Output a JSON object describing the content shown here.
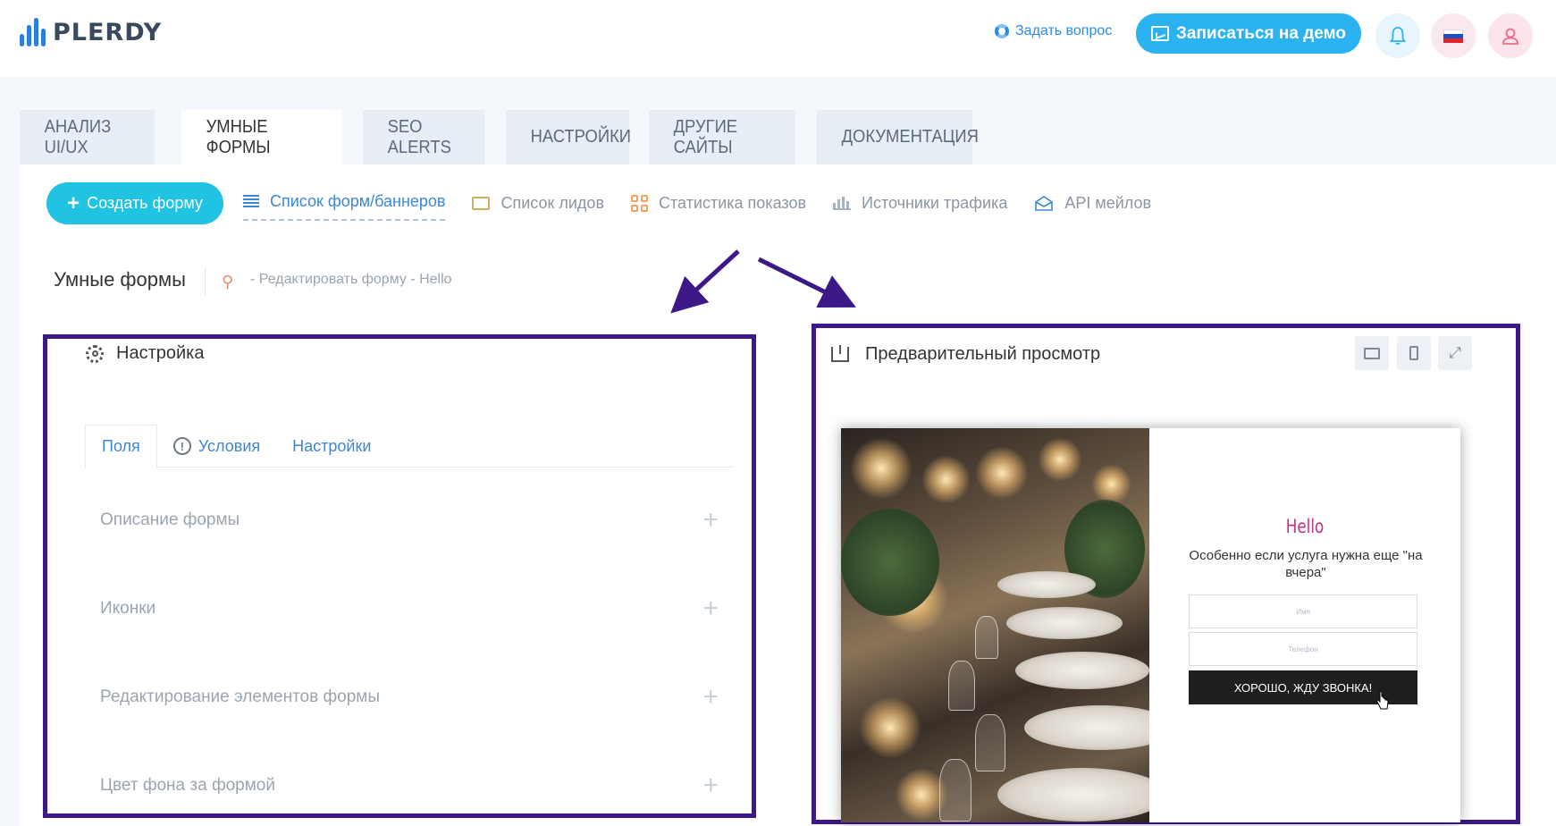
{
  "header": {
    "logo_text": "PLERDY",
    "ask_label": "Задать вопрос",
    "demo_label": "Записаться на демо",
    "colors": {
      "accent": "#2ab3f0",
      "brand": "#2b7de0"
    }
  },
  "tabs": [
    {
      "label": "АНАЛИЗ UI/UX"
    },
    {
      "label": "УМНЫЕ ФОРМЫ"
    },
    {
      "label": "SEO ALERTS"
    },
    {
      "label": "НАСТРОЙКИ"
    },
    {
      "label": "ДРУГИЕ САЙТЫ"
    },
    {
      "label": "ДОКУМЕНТАЦИЯ"
    }
  ],
  "subnav": {
    "create_label": "Создать форму",
    "items": [
      {
        "label": "Список форм/баннеров",
        "icon": "list-icon"
      },
      {
        "label": "Список лидов",
        "icon": "folder-icon"
      },
      {
        "label": "Статистика показов",
        "icon": "grid-icon"
      },
      {
        "label": "Источники трафика",
        "icon": "bar-chart-icon"
      },
      {
        "label": "API мейлов",
        "icon": "envelope-icon"
      }
    ]
  },
  "breadcrumb": {
    "title": "Умные формы",
    "sub": "- Редактировать форму - Hello"
  },
  "settings": {
    "title": "Настройка",
    "tabs": [
      {
        "label": "Поля"
      },
      {
        "label": "Условия"
      },
      {
        "label": "Настройки"
      }
    ],
    "sections": [
      {
        "label": "Описание формы"
      },
      {
        "label": "Иконки"
      },
      {
        "label": "Редактирование элементов формы"
      },
      {
        "label": "Цвет фона за формой"
      }
    ]
  },
  "preview": {
    "title": "Предварительный просмотр",
    "popup": {
      "title": "Hello",
      "text": "Особенно если услуга нужна еще \"на вчера\"",
      "name_placeholder": "Имя",
      "phone_placeholder": "Телефон",
      "button_label": "ХОРОШО, ЖДУ ЗВОНКА!"
    }
  }
}
